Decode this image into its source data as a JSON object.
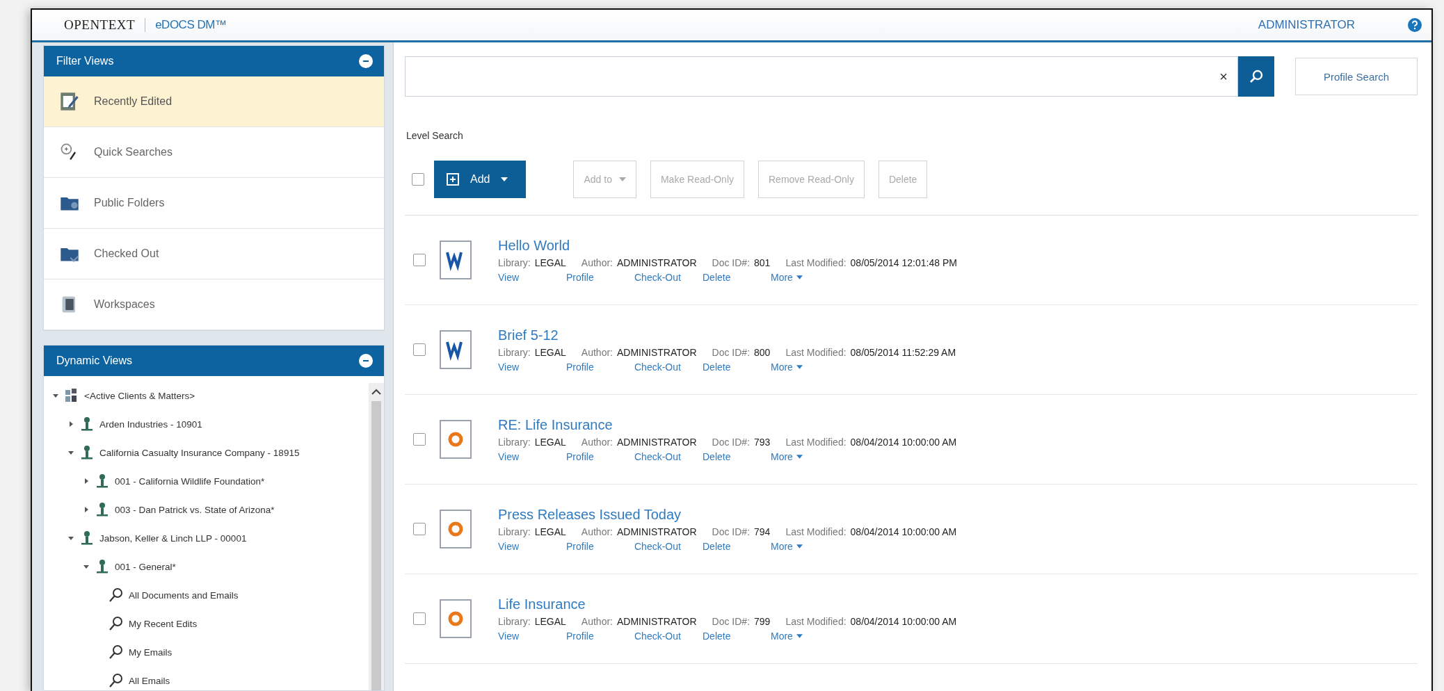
{
  "header": {
    "brand": "OPENTEXT",
    "product": "eDOCS DM™",
    "user": "ADMINISTRATOR"
  },
  "filter_views": {
    "title": "Filter Views",
    "items": [
      {
        "label": "Recently Edited",
        "kind": "edited",
        "selected": true
      },
      {
        "label": "Quick Searches",
        "kind": "quick",
        "selected": false
      },
      {
        "label": "Public Folders",
        "kind": "public",
        "selected": false
      },
      {
        "label": "Checked Out",
        "kind": "checked",
        "selected": false
      },
      {
        "label": "Workspaces",
        "kind": "workspace",
        "selected": false
      }
    ]
  },
  "dynamic_views": {
    "title": "Dynamic Views",
    "tree": [
      {
        "label": "<Active Clients & Matters>",
        "kind": "group",
        "expanded": true,
        "children": [
          {
            "label": "Arden Industries - 10901",
            "kind": "client",
            "expanded": false
          },
          {
            "label": "California Casualty Insurance Company - 18915",
            "kind": "client",
            "expanded": true,
            "children": [
              {
                "label": "001 - California Wildlife Foundation*",
                "kind": "client",
                "expanded": false
              },
              {
                "label": "003 - Dan Patrick vs. State of Arizona*",
                "kind": "client",
                "expanded": false
              }
            ]
          },
          {
            "label": "Jabson, Keller & Linch LLP - 00001",
            "kind": "client",
            "expanded": true,
            "children": [
              {
                "label": "001 - General*",
                "kind": "client",
                "expanded": true,
                "children": [
                  {
                    "label": "All Documents and Emails",
                    "kind": "search"
                  },
                  {
                    "label": "My Recent Edits",
                    "kind": "search"
                  },
                  {
                    "label": "My Emails",
                    "kind": "search"
                  },
                  {
                    "label": "All Emails",
                    "kind": "search"
                  }
                ]
              }
            ]
          }
        ]
      }
    ]
  },
  "search": {
    "clear": "×",
    "profile_button": "Profile Search",
    "level_label": "Level Search"
  },
  "toolbar": {
    "select_all_checked": false,
    "buttons": [
      {
        "label": "Add",
        "kind": "primary",
        "disabled": false,
        "dropdown": true
      },
      {
        "label": "Add to",
        "kind": "plain",
        "disabled": true,
        "dropdown": true
      },
      {
        "label": "Make Read-Only",
        "kind": "plain",
        "disabled": true,
        "dropdown": false
      },
      {
        "label": "Remove Read-Only",
        "kind": "plain",
        "disabled": true,
        "dropdown": false
      },
      {
        "label": "Delete",
        "kind": "plain",
        "disabled": true,
        "dropdown": false
      }
    ]
  },
  "documents": [
    {
      "title": "Hello World",
      "kind": "word",
      "checked": false,
      "library_label": "Library:",
      "library": "LEGAL",
      "author_label": "Author:",
      "author": "ADMINISTRATOR",
      "docid_label": "Doc ID#:",
      "docid": "801",
      "modified_label": "Last Modified:",
      "modified": "08/05/2014 12:01:48 PM",
      "actions": [
        {
          "label": "View",
          "dropdown": false
        },
        {
          "label": "Profile",
          "dropdown": false
        },
        {
          "label": "Check-Out",
          "dropdown": false
        },
        {
          "label": "Delete",
          "dropdown": false
        },
        {
          "label": "More",
          "dropdown": true
        }
      ]
    },
    {
      "title": "Brief 5-12",
      "kind": "word",
      "checked": false,
      "library_label": "Library:",
      "library": "LEGAL",
      "author_label": "Author:",
      "author": "ADMINISTRATOR",
      "docid_label": "Doc ID#:",
      "docid": "800",
      "modified_label": "Last Modified:",
      "modified": "08/05/2014 11:52:29 AM",
      "actions": [
        {
          "label": "View",
          "dropdown": false
        },
        {
          "label": "Profile",
          "dropdown": false
        },
        {
          "label": "Check-Out",
          "dropdown": false
        },
        {
          "label": "Delete",
          "dropdown": false
        },
        {
          "label": "More",
          "dropdown": true
        }
      ]
    },
    {
      "title": "RE: Life Insurance",
      "kind": "mail",
      "checked": false,
      "library_label": "Library:",
      "library": "LEGAL",
      "author_label": "Author:",
      "author": "ADMINISTRATOR",
      "docid_label": "Doc ID#:",
      "docid": "793",
      "modified_label": "Last Modified:",
      "modified": "08/04/2014 10:00:00 AM",
      "actions": [
        {
          "label": "View",
          "dropdown": false
        },
        {
          "label": "Profile",
          "dropdown": false
        },
        {
          "label": "Check-Out",
          "dropdown": false
        },
        {
          "label": "Delete",
          "dropdown": false
        },
        {
          "label": "More",
          "dropdown": true
        }
      ]
    },
    {
      "title": "Press Releases Issued Today",
      "kind": "mail",
      "checked": false,
      "library_label": "Library:",
      "library": "LEGAL",
      "author_label": "Author:",
      "author": "ADMINISTRATOR",
      "docid_label": "Doc ID#:",
      "docid": "794",
      "modified_label": "Last Modified:",
      "modified": "08/04/2014 10:00:00 AM",
      "actions": [
        {
          "label": "View",
          "dropdown": false
        },
        {
          "label": "Profile",
          "dropdown": false
        },
        {
          "label": "Check-Out",
          "dropdown": false
        },
        {
          "label": "Delete",
          "dropdown": false
        },
        {
          "label": "More",
          "dropdown": true
        }
      ]
    },
    {
      "title": "Life Insurance",
      "kind": "mail",
      "checked": false,
      "library_label": "Library:",
      "library": "LEGAL",
      "author_label": "Author:",
      "author": "ADMINISTRATOR",
      "docid_label": "Doc ID#:",
      "docid": "799",
      "modified_label": "Last Modified:",
      "modified": "08/04/2014 10:00:00 AM",
      "actions": [
        {
          "label": "View",
          "dropdown": false
        },
        {
          "label": "Profile",
          "dropdown": false
        },
        {
          "label": "Check-Out",
          "dropdown": false
        },
        {
          "label": "Delete",
          "dropdown": false
        },
        {
          "label": "More",
          "dropdown": true
        }
      ]
    }
  ]
}
